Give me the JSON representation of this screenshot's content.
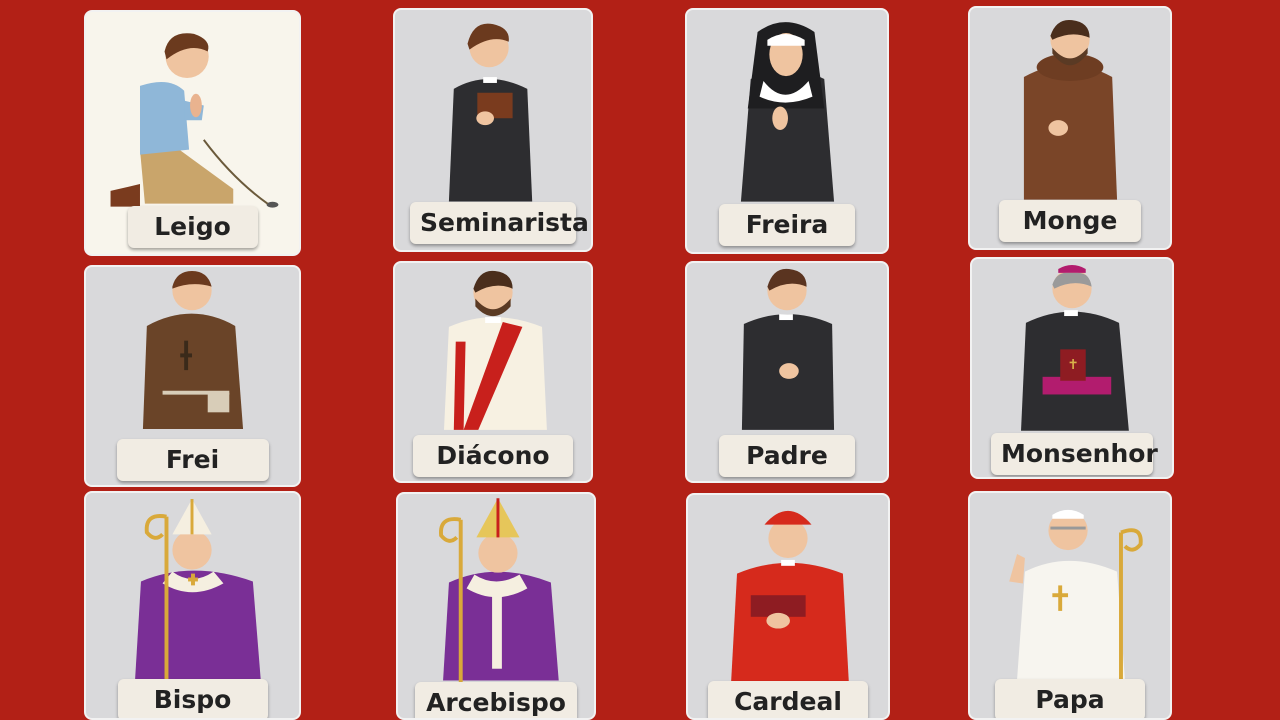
{
  "colors": {
    "background": "#b22016",
    "card": "#d9d9db",
    "card_highlight": "#f8f5ec",
    "label_bg": "#f1ece3"
  },
  "cards": [
    {
      "label": "Leigo",
      "icon": "layperson-praying-icon"
    },
    {
      "label": "Seminarista",
      "icon": "seminarian-icon"
    },
    {
      "label": "Freira",
      "icon": "nun-icon"
    },
    {
      "label": "Monge",
      "icon": "monk-icon"
    },
    {
      "label": "Frei",
      "icon": "friar-icon"
    },
    {
      "label": "Diácono",
      "icon": "deacon-icon"
    },
    {
      "label": "Padre",
      "icon": "priest-icon"
    },
    {
      "label": "Monsenhor",
      "icon": "monsignor-icon"
    },
    {
      "label": "Bispo",
      "icon": "bishop-icon"
    },
    {
      "label": "Arcebispo",
      "icon": "archbishop-icon"
    },
    {
      "label": "Cardeal",
      "icon": "cardinal-icon"
    },
    {
      "label": "Papa",
      "icon": "pope-icon"
    }
  ]
}
